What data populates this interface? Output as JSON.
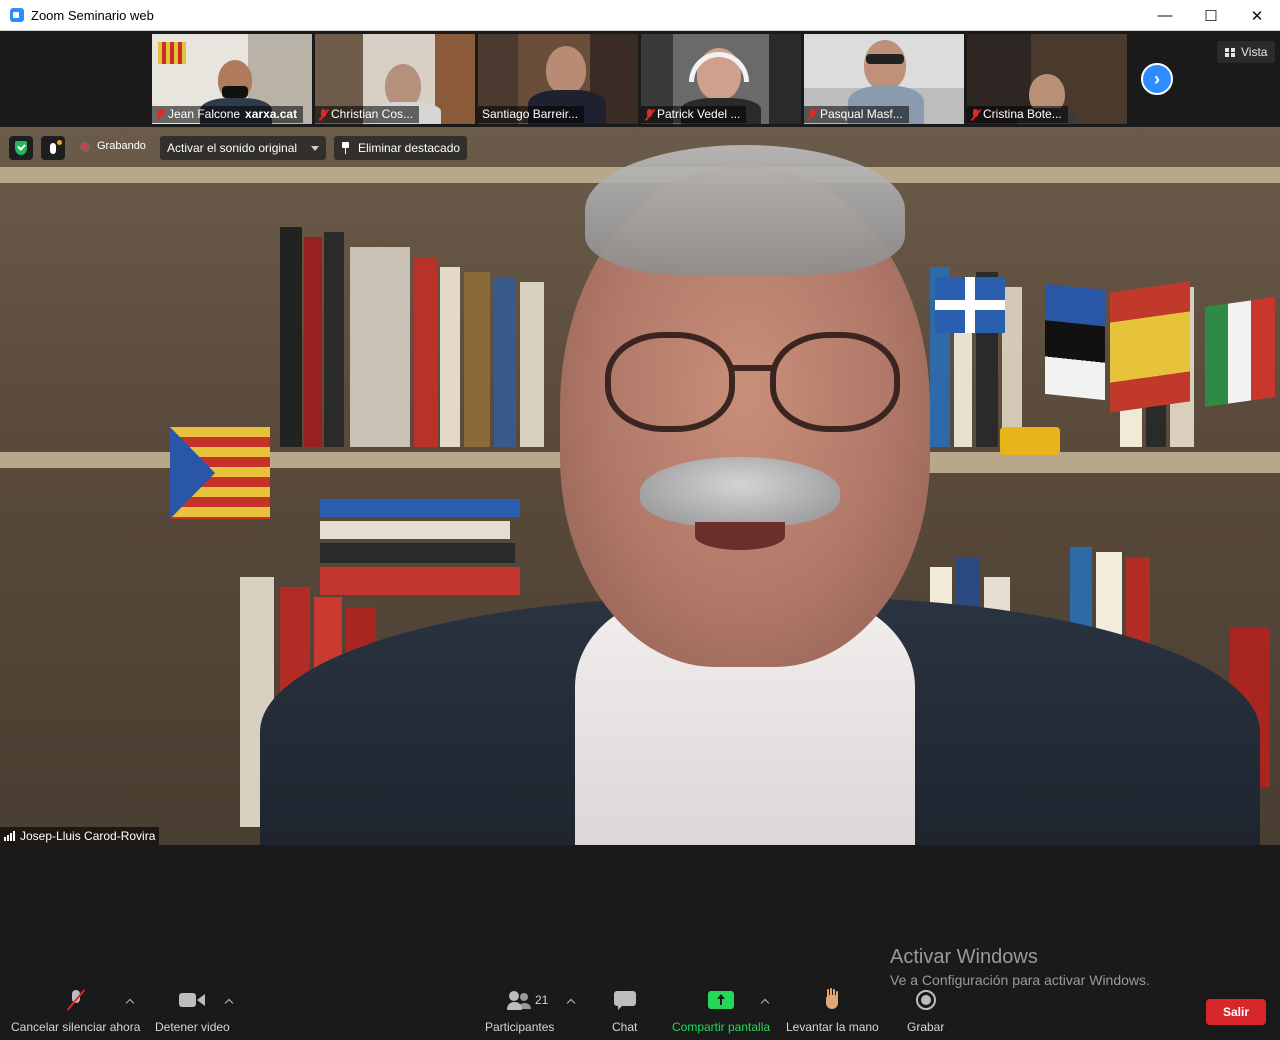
{
  "window": {
    "title": "Zoom Seminario web",
    "minimize": "—",
    "maximize": "☐",
    "close": "✕"
  },
  "thumbnails": [
    {
      "name": "Jean Falcone",
      "badge": "xarxa.cat",
      "muted": true
    },
    {
      "name": "Christian Cos...",
      "muted": true
    },
    {
      "name": "Santiago Barreir...",
      "muted": false
    },
    {
      "name": "Patrick Vedel ...",
      "muted": true
    },
    {
      "name": "Pasqual Masf...",
      "muted": true
    },
    {
      "name": "Cristina Bote...",
      "muted": true
    }
  ],
  "view_button": {
    "label": "Vista",
    "icon": "grid-icon"
  },
  "next_page_icon": "chevron-right-icon",
  "next_page_glyph": "›",
  "overlay": {
    "recording": "Grabando",
    "original_sound": "Activar el sonido original",
    "unpin": "Eliminar destacado"
  },
  "active_speaker": {
    "name": "Josep-Lluis Carod-Rovira"
  },
  "watermark": {
    "title": "Activar Windows",
    "subtitle": "Ve a Configuración para activar Windows."
  },
  "toolbar": {
    "mute": "Cancelar silenciar ahora",
    "video": "Detener video",
    "participants": "Participantes",
    "participants_count": "21",
    "chat": "Chat",
    "share": "Compartir pantalla",
    "raise_hand": "Levantar la mano",
    "record": "Grabar",
    "leave": "Salir"
  },
  "colors": {
    "accent": "#2d8cff",
    "share_green": "#23d959",
    "leave_red": "#d9262b",
    "mute_red": "#e02828"
  }
}
